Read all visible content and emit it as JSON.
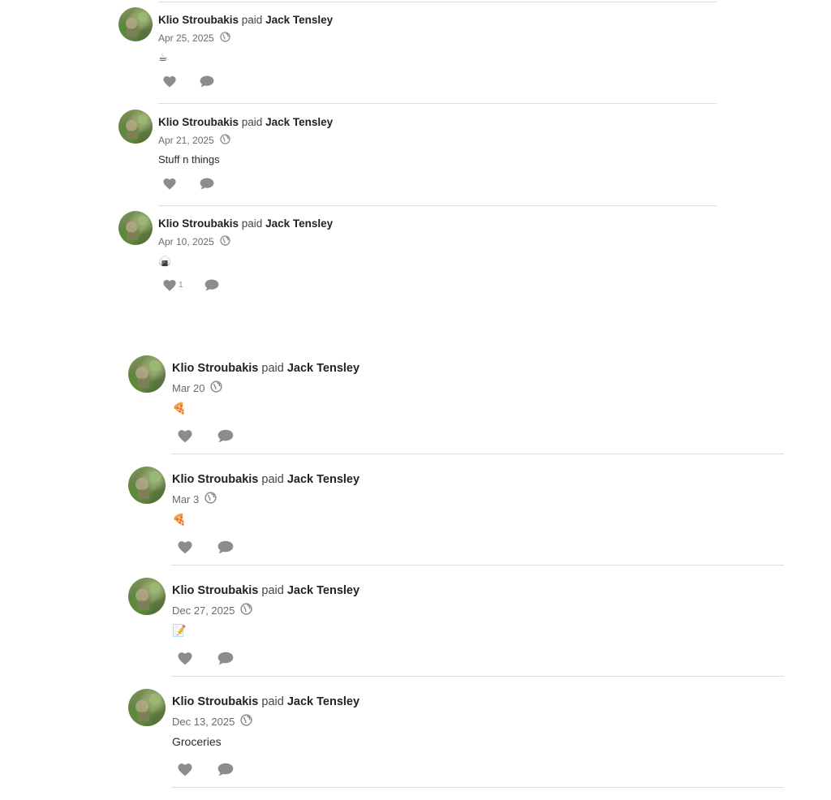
{
  "feed": {
    "items": [
      {
        "payer": "Klio Stroubakis",
        "verb": "paid",
        "payee": "Jack Tensley",
        "date": "Apr 25, 2025",
        "note": "☕",
        "likes": ""
      },
      {
        "payer": "Klio Stroubakis",
        "verb": "paid",
        "payee": "Jack Tensley",
        "date": "Apr 21, 2025",
        "note": "Stuff n things",
        "likes": ""
      },
      {
        "payer": "Klio Stroubakis",
        "verb": "paid",
        "payee": "Jack Tensley",
        "date": "Apr 10, 2025",
        "note": "🍙",
        "likes": "1"
      },
      {
        "payer": "Klio Stroubakis",
        "verb": "paid",
        "payee": "Jack Tensley",
        "date": "Mar 20",
        "note": "🍕",
        "likes": ""
      },
      {
        "payer": "Klio Stroubakis",
        "verb": "paid",
        "payee": "Jack Tensley",
        "date": "Mar 3",
        "note": "🍕",
        "likes": ""
      },
      {
        "payer": "Klio Stroubakis",
        "verb": "paid",
        "payee": "Jack Tensley",
        "date": "Dec 27, 2025",
        "note": "📝",
        "likes": ""
      },
      {
        "payer": "Klio Stroubakis",
        "verb": "paid",
        "payee": "Jack Tensley",
        "date": "Dec 13, 2025",
        "note": "Groceries",
        "likes": ""
      }
    ]
  },
  "icons": {
    "privacy": "globe-icon",
    "like": "heart-icon",
    "comment": "comment-bubble-icon"
  },
  "colors": {
    "icon_gray": "#8c8c8c",
    "divider": "#dcdcdc",
    "text_primary": "#222222",
    "text_secondary": "#6b6b6b"
  }
}
